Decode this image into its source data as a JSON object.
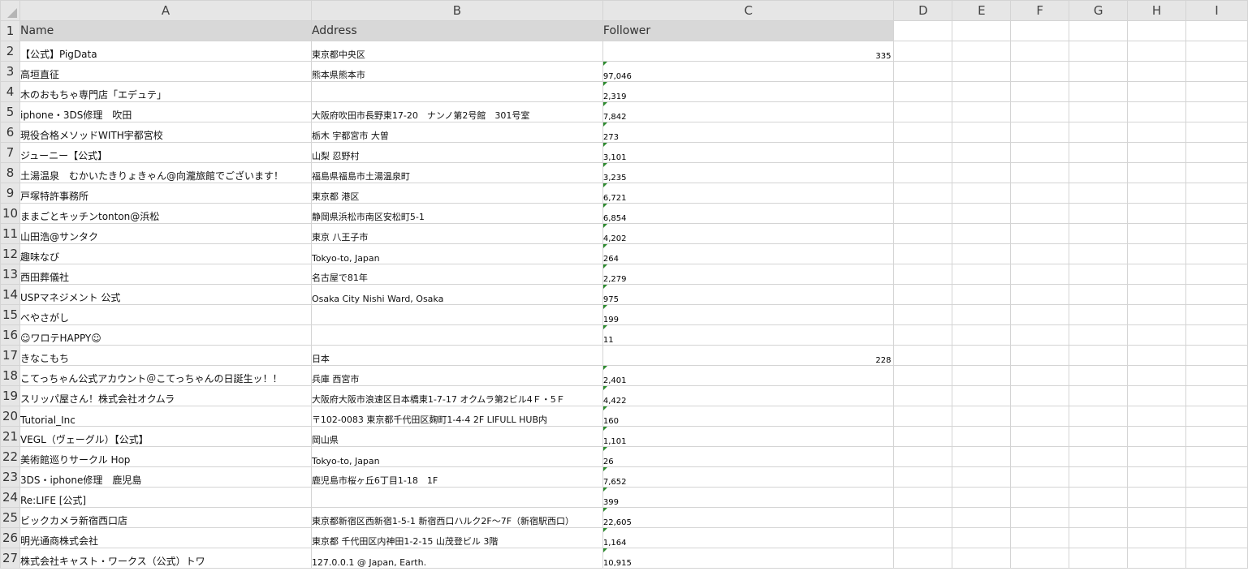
{
  "columns": [
    "A",
    "B",
    "C",
    "D",
    "E",
    "F",
    "G",
    "H",
    "I"
  ],
  "header": {
    "row": "1",
    "name": "Name",
    "address": "Address",
    "follower": "Follower"
  },
  "rows": [
    {
      "num": "2",
      "name": "【公式】PigData",
      "address": "東京都中央区",
      "follower": "335",
      "align": "right",
      "text_flag": false
    },
    {
      "num": "3",
      "name": "高垣直征",
      "address": "熊本県熊本市",
      "follower": "97,046",
      "align": "left",
      "text_flag": true
    },
    {
      "num": "4",
      "name": "木のおもちゃ専門店「エデュテ」",
      "address": "",
      "follower": "2,319",
      "align": "left",
      "text_flag": true
    },
    {
      "num": "5",
      "name": "iphone・3DS修理　吹田",
      "address": "大阪府吹田市長野東17-20　ナンノ第2号館　301号室",
      "follower": "7,842",
      "align": "left",
      "text_flag": true
    },
    {
      "num": "6",
      "name": "現役合格メソッドWITH宇都宮校",
      "address": "栃木 宇都宮市 大曽",
      "follower": "273",
      "align": "left",
      "text_flag": true
    },
    {
      "num": "7",
      "name": "ジューニー【公式】",
      "address": "山梨 忍野村",
      "follower": "3,101",
      "align": "left",
      "text_flag": true
    },
    {
      "num": "8",
      "name": "土湯温泉　むかいたきりょきゃん@向瀧旅館でございます！",
      "address": "福島県福島市土湯温泉町",
      "follower": "3,235",
      "align": "left",
      "text_flag": true
    },
    {
      "num": "9",
      "name": "戸塚特許事務所",
      "address": "東京都 港区",
      "follower": "6,721",
      "align": "left",
      "text_flag": true
    },
    {
      "num": "10",
      "name": "ままごとキッチンtonton@浜松",
      "address": "静岡県浜松市南区安松町5-1",
      "follower": "6,854",
      "align": "left",
      "text_flag": true
    },
    {
      "num": "11",
      "name": "山田浩@サンタク",
      "address": "東京 八王子市",
      "follower": "4,202",
      "align": "left",
      "text_flag": true
    },
    {
      "num": "12",
      "name": "趣味なび",
      "address": "Tokyo-to, Japan",
      "follower": "264",
      "align": "left",
      "text_flag": true
    },
    {
      "num": "13",
      "name": "西田葬儀社",
      "address": "名古屋で81年",
      "follower": "2,279",
      "align": "left",
      "text_flag": true
    },
    {
      "num": "14",
      "name": "USPマネジメント 公式",
      "address": "Osaka City Nishi Ward, Osaka",
      "follower": "975",
      "align": "left",
      "text_flag": true
    },
    {
      "num": "15",
      "name": "べやさがし",
      "address": "",
      "follower": "199",
      "align": "left",
      "text_flag": true
    },
    {
      "num": "16",
      "name": "☺ワロテHAPPY☺",
      "address": "",
      "follower": "11",
      "align": "left",
      "text_flag": true
    },
    {
      "num": "17",
      "name": "きなこもち",
      "address": "日本",
      "follower": "228",
      "align": "right",
      "text_flag": false
    },
    {
      "num": "18",
      "name": "こてっちゃん公式アカウント＠こてっちゃんの日誕生ッ！！",
      "address": "兵庫 西宮市",
      "follower": "2,401",
      "align": "left",
      "text_flag": true
    },
    {
      "num": "19",
      "name": "スリッパ屋さん！株式会社オクムラ",
      "address": "大阪府大阪市浪速区日本橋東1-7-17 オクムラ第2ビル4Ｆ・5Ｆ",
      "follower": "4,422",
      "align": "left",
      "text_flag": true
    },
    {
      "num": "20",
      "name": "Tutorial_Inc",
      "address": "〒102-0083 東京都千代田区麹町1-4-4 2F LIFULL HUB内",
      "follower": "160",
      "align": "left",
      "text_flag": true
    },
    {
      "num": "21",
      "name": "VEGL（ヴェーグル）【公式】",
      "address": "岡山県",
      "follower": "1,101",
      "align": "left",
      "text_flag": true
    },
    {
      "num": "22",
      "name": "美術館巡りサークル Hop",
      "address": "Tokyo-to, Japan",
      "follower": "26",
      "align": "left",
      "text_flag": true
    },
    {
      "num": "23",
      "name": "3DS・iphone修理　鹿児島",
      "address": "鹿児島市桜ヶ丘6丁目1-18　1F",
      "follower": "7,652",
      "align": "left",
      "text_flag": true
    },
    {
      "num": "24",
      "name": "Re:LIFE [公式]",
      "address": "",
      "follower": "399",
      "align": "left",
      "text_flag": true
    },
    {
      "num": "25",
      "name": "ビックカメラ新宿西口店",
      "address": "東京都新宿区西新宿1-5-1 新宿西口ハルク2F～7F（新宿駅西口）",
      "follower": "22,605",
      "align": "left",
      "text_flag": true
    },
    {
      "num": "26",
      "name": "明光通商株式会社",
      "address": "東京都 千代田区内神田1-2-15 山茂登ビル 3階",
      "follower": "1,164",
      "align": "left",
      "text_flag": true
    },
    {
      "num": "27",
      "name": "株式会社キャスト・ワークス（公式）トワ",
      "address": "127.0.0.1 @ Japan, Earth.",
      "follower": "10,915",
      "align": "left",
      "text_flag": true
    }
  ]
}
